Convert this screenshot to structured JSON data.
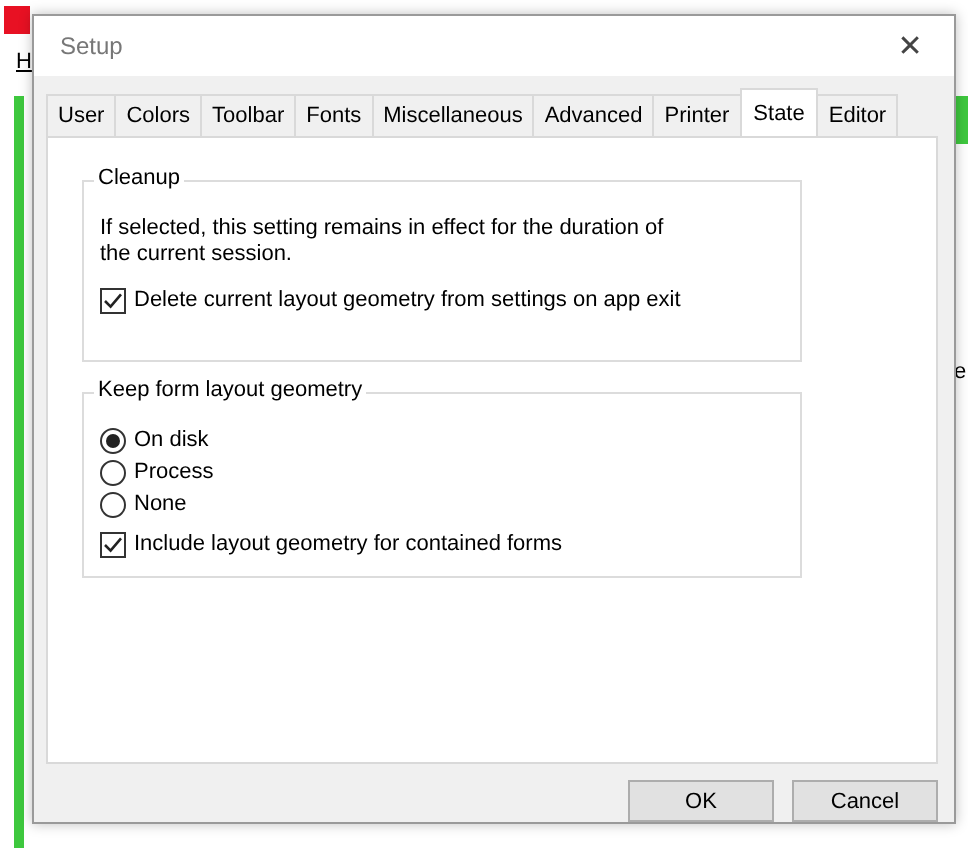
{
  "background_app": {
    "menu_fragment": "H",
    "side_fragment": "e"
  },
  "dialog": {
    "title": "Setup",
    "close": "✕"
  },
  "tabs": [
    {
      "label": "User",
      "selected": false
    },
    {
      "label": "Colors",
      "selected": false
    },
    {
      "label": "Toolbar",
      "selected": false
    },
    {
      "label": "Fonts",
      "selected": false
    },
    {
      "label": "Miscellaneous",
      "selected": false
    },
    {
      "label": "Advanced",
      "selected": false
    },
    {
      "label": "Printer",
      "selected": false
    },
    {
      "label": "State",
      "selected": true
    },
    {
      "label": "Editor",
      "selected": false
    }
  ],
  "groups": [
    {
      "title": "Cleanup",
      "items": [
        {
          "kind": "text",
          "label": "If selected, this setting remains in effect for the duration of the current session."
        },
        {
          "kind": "checkbox",
          "label": "Delete current layout geometry from settings on app exit",
          "checked": true
        }
      ]
    },
    {
      "title": "Keep form layout geometry",
      "items": [
        {
          "kind": "radio",
          "label": "On disk",
          "selected": true
        },
        {
          "kind": "radio",
          "label": "Process",
          "selected": false
        },
        {
          "kind": "radio",
          "label": "None",
          "selected": false
        },
        {
          "kind": "checkbox",
          "label": "Include layout geometry for contained forms",
          "checked": true
        }
      ]
    }
  ],
  "buttons": [
    "OK",
    "Cancel"
  ]
}
